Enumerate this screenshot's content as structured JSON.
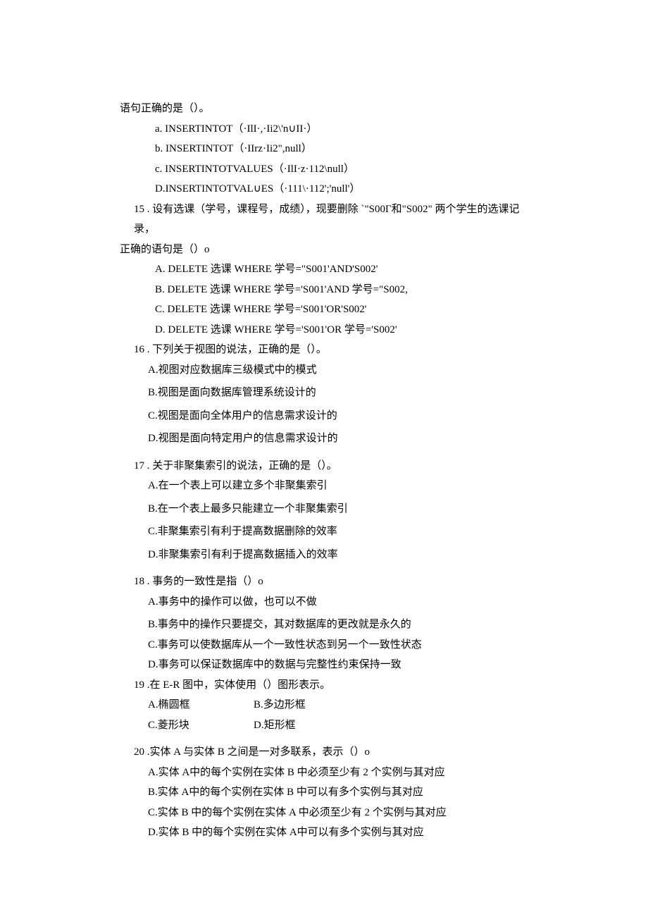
{
  "intro": {
    "line1": "语句正确的是（）。",
    "a": "a.    INSERTINTOT（·IlI·,·Ii2\\'n∪II·）",
    "b": "b.    INSERTINTOT（·IIrz·Ii2\",null）",
    "c": "c.    INSERTINTOTVALUES（·IlI·z·112\\null）",
    "d": "D.INSERTINTOTVAL∪ES（·111\\·112';'null'）"
  },
  "q15": {
    "stem_a": "15 . 设有选课（学号，课程号，成绩），现要删除 `\"S00Γ和\"S002\" 两个学生的选课记录，",
    "stem_b": "正确的语句是（）o",
    "A": "A.    DELETE 选课 WHERE 学号=\"S001'AND'S002'",
    "B": "B.    DELETE 选课 WHERE 学号='S001'AND 学号=\"S002,",
    "C": "C.    DELETE 选课 WHERE 学号='S001'OR'S002'",
    "D": "D.    DELETE 选课 WHERE 学号='S001'OR 学号='S002'"
  },
  "q16": {
    "stem": "16 . 下列关于视图的说法，正确的是（）。",
    "A": "A.视图对应数据库三级模式中的模式",
    "B": "B.视图是面向数据库管理系统设计的",
    "C": "C.视图是面向全体用户的信息需求设计的",
    "D": "D.视图是面向特定用户的信息需求设计的"
  },
  "q17": {
    "stem": "17 . 关于非聚集索引的说法，正确的是（）。",
    "A": "A.在一个表上可以建立多个非聚集索引",
    "B": "B.在一个表上最多只能建立一个非聚集索引",
    "C": "C.非聚集索引有利于提高数据删除的效率",
    "D": "D.非聚集索引有利于提高数据插入的效率"
  },
  "q18": {
    "stem": "18 . 事务的一致性是指（）o",
    "A": "A.事务中的操作可以做，也可以不做",
    "B": "B.事务中的操作只要提交，其对数据库的更改就是永久的",
    "C": "C.事务可以使数据库从一个一致性状态到另一个一致性状态",
    "D": "D.事务可以保证数据库中的数据与完整性约束保持一致"
  },
  "q19": {
    "stem": "19 .在 E-R 图中，实体使用（）图形表示。",
    "A": "A.椭圆框",
    "B": "B.多边形框",
    "C": "C.菱形块",
    "D": "D.矩形框"
  },
  "q20": {
    "stem": "20 .实体 A 与实体 B 之间是一对多联系，表示（）o",
    "A": "A.实体 A中的每个实例在实体 B 中必须至少有 2 个实例与其对应",
    "B": "B.实体 A中的每个实例在实体 B 中可以有多个实例与其对应",
    "C": "C.实体 B 中的每个实例在实体 A 中必须至少有 2 个实例与其对应",
    "D": "D.实体 B 中的每个实例在实体 A中可以有多个实例与其对应"
  }
}
